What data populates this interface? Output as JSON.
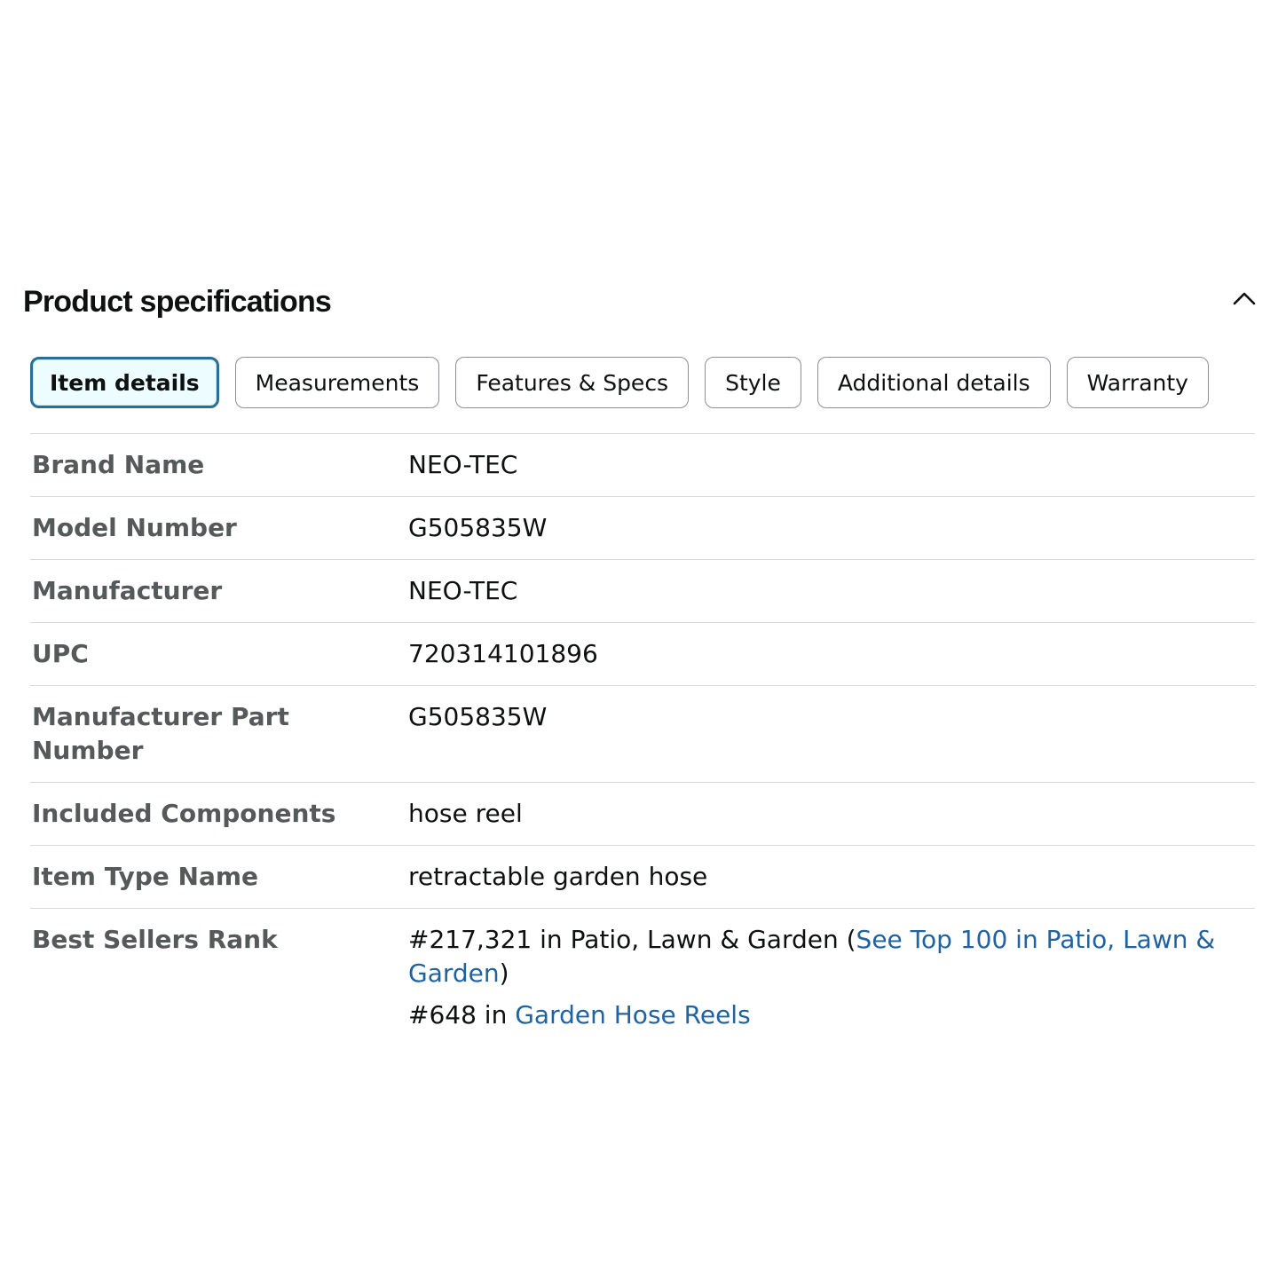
{
  "section": {
    "title": "Product specifications"
  },
  "tabs": [
    {
      "label": "Item details",
      "active": true
    },
    {
      "label": "Measurements",
      "active": false
    },
    {
      "label": "Features & Specs",
      "active": false
    },
    {
      "label": "Style",
      "active": false
    },
    {
      "label": "Additional details",
      "active": false
    },
    {
      "label": "Warranty",
      "active": false
    }
  ],
  "specs": [
    {
      "label": "Brand Name",
      "value": "NEO-TEC"
    },
    {
      "label": "Model Number",
      "value": "G505835W"
    },
    {
      "label": "Manufacturer",
      "value": "NEO-TEC"
    },
    {
      "label": "UPC",
      "value": "720314101896"
    },
    {
      "label": "Manufacturer Part Number",
      "value": "G505835W"
    },
    {
      "label": "Included Components",
      "value": "hose reel"
    },
    {
      "label": "Item Type Name",
      "value": "retractable garden hose"
    }
  ],
  "best_sellers": {
    "label": "Best Sellers Rank",
    "rank1": {
      "prefix": "#217,321 in Patio, Lawn & Garden (",
      "link": "See Top 100 in Patio, Lawn & Garden",
      "suffix": ")"
    },
    "rank2": {
      "prefix": "#648 in ",
      "link": "Garden Hose Reels"
    }
  },
  "icons": {
    "collapse": "chevron-up-icon"
  },
  "colors": {
    "active_tab_border": "#2a6e96",
    "active_tab_bg": "#edfdff",
    "link": "#2162a1",
    "label_text": "#565959",
    "divider": "#d5d9d9"
  }
}
